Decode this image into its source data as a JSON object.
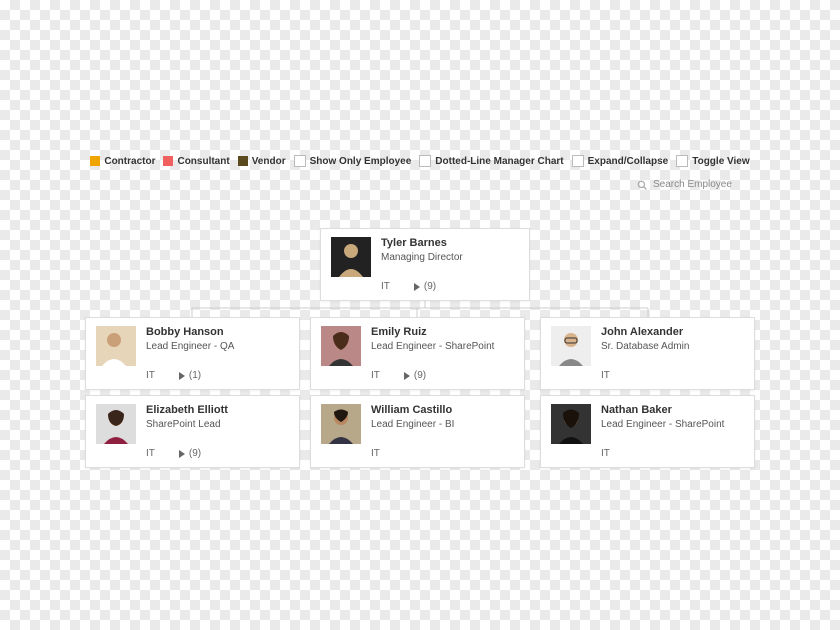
{
  "legend": {
    "contractor": "Contractor",
    "consultant": "Consultant",
    "vendor": "Vendor",
    "show_only_employee": "Show Only Employee",
    "dotted_line": "Dotted-Line Manager Chart",
    "expand_collapse": "Expand/Collapse",
    "toggle_view": "Toggle View"
  },
  "search": {
    "placeholder": "Search Employee"
  },
  "root": {
    "name": "Tyler Barnes",
    "title": "Managing Director",
    "dept": "IT",
    "reports": "(9)"
  },
  "row1": [
    {
      "name": "Bobby Hanson",
      "title": "Lead Engineer - QA",
      "dept": "IT",
      "reports": "(1)"
    },
    {
      "name": "Emily Ruiz",
      "title": "Lead Engineer - SharePoint",
      "dept": "IT",
      "reports": "(9)"
    },
    {
      "name": "John Alexander",
      "title": "Sr. Database Admin",
      "dept": "IT",
      "reports": null
    }
  ],
  "row2": [
    {
      "name": "Elizabeth Elliott",
      "title": "SharePoint Lead",
      "dept": "IT",
      "reports": "(9)"
    },
    {
      "name": "William Castillo",
      "title": "Lead Engineer - BI",
      "dept": "IT",
      "reports": null
    },
    {
      "name": "Nathan Baker",
      "title": "Lead Engineer - SharePoint",
      "dept": "IT",
      "reports": null
    }
  ]
}
